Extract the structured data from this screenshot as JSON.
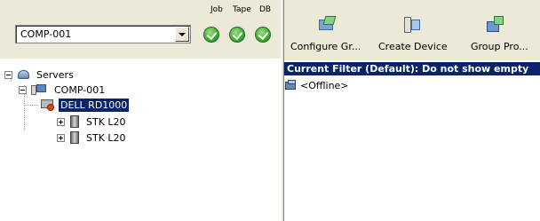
{
  "server_selector": {
    "value": "COMP-001"
  },
  "status": {
    "labels": [
      "Job",
      "Tape",
      "DB"
    ],
    "icons": [
      "check-ok-icon",
      "check-ok-icon",
      "check-ok-icon"
    ]
  },
  "tree": {
    "root": "Servers",
    "computer": "COMP-001",
    "device": "DELL RD1000",
    "libraries": [
      "STK L20",
      "STK L20"
    ]
  },
  "toolbar": {
    "configure_label": "Configure Gr...",
    "create_label": "Create Device",
    "group_label": "Group Pro..."
  },
  "filter_text": "Current Filter (Default):  Do not show empty",
  "items": [
    "<Offline>"
  ],
  "colors": {
    "selection": "#0a246a",
    "panel": "#ece9d8",
    "ok": "#3aa935"
  }
}
